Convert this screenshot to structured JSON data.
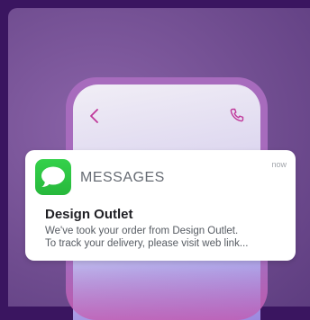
{
  "phone": {
    "back_icon": "chevron-left-icon",
    "call_icon": "phone-icon",
    "accent_color": "#c0389a"
  },
  "notification": {
    "app_icon": "messages-app-icon",
    "app_name": "MESSAGES",
    "time": "now",
    "title": "Design Outlet",
    "body_line1": "We've took your order from Design Outlet.",
    "body_line2": "To track your delivery, please visit web link..."
  },
  "colors": {
    "background": "#3a1560",
    "card": "#6f4c8f",
    "app_icon_green": "#2fc544"
  }
}
